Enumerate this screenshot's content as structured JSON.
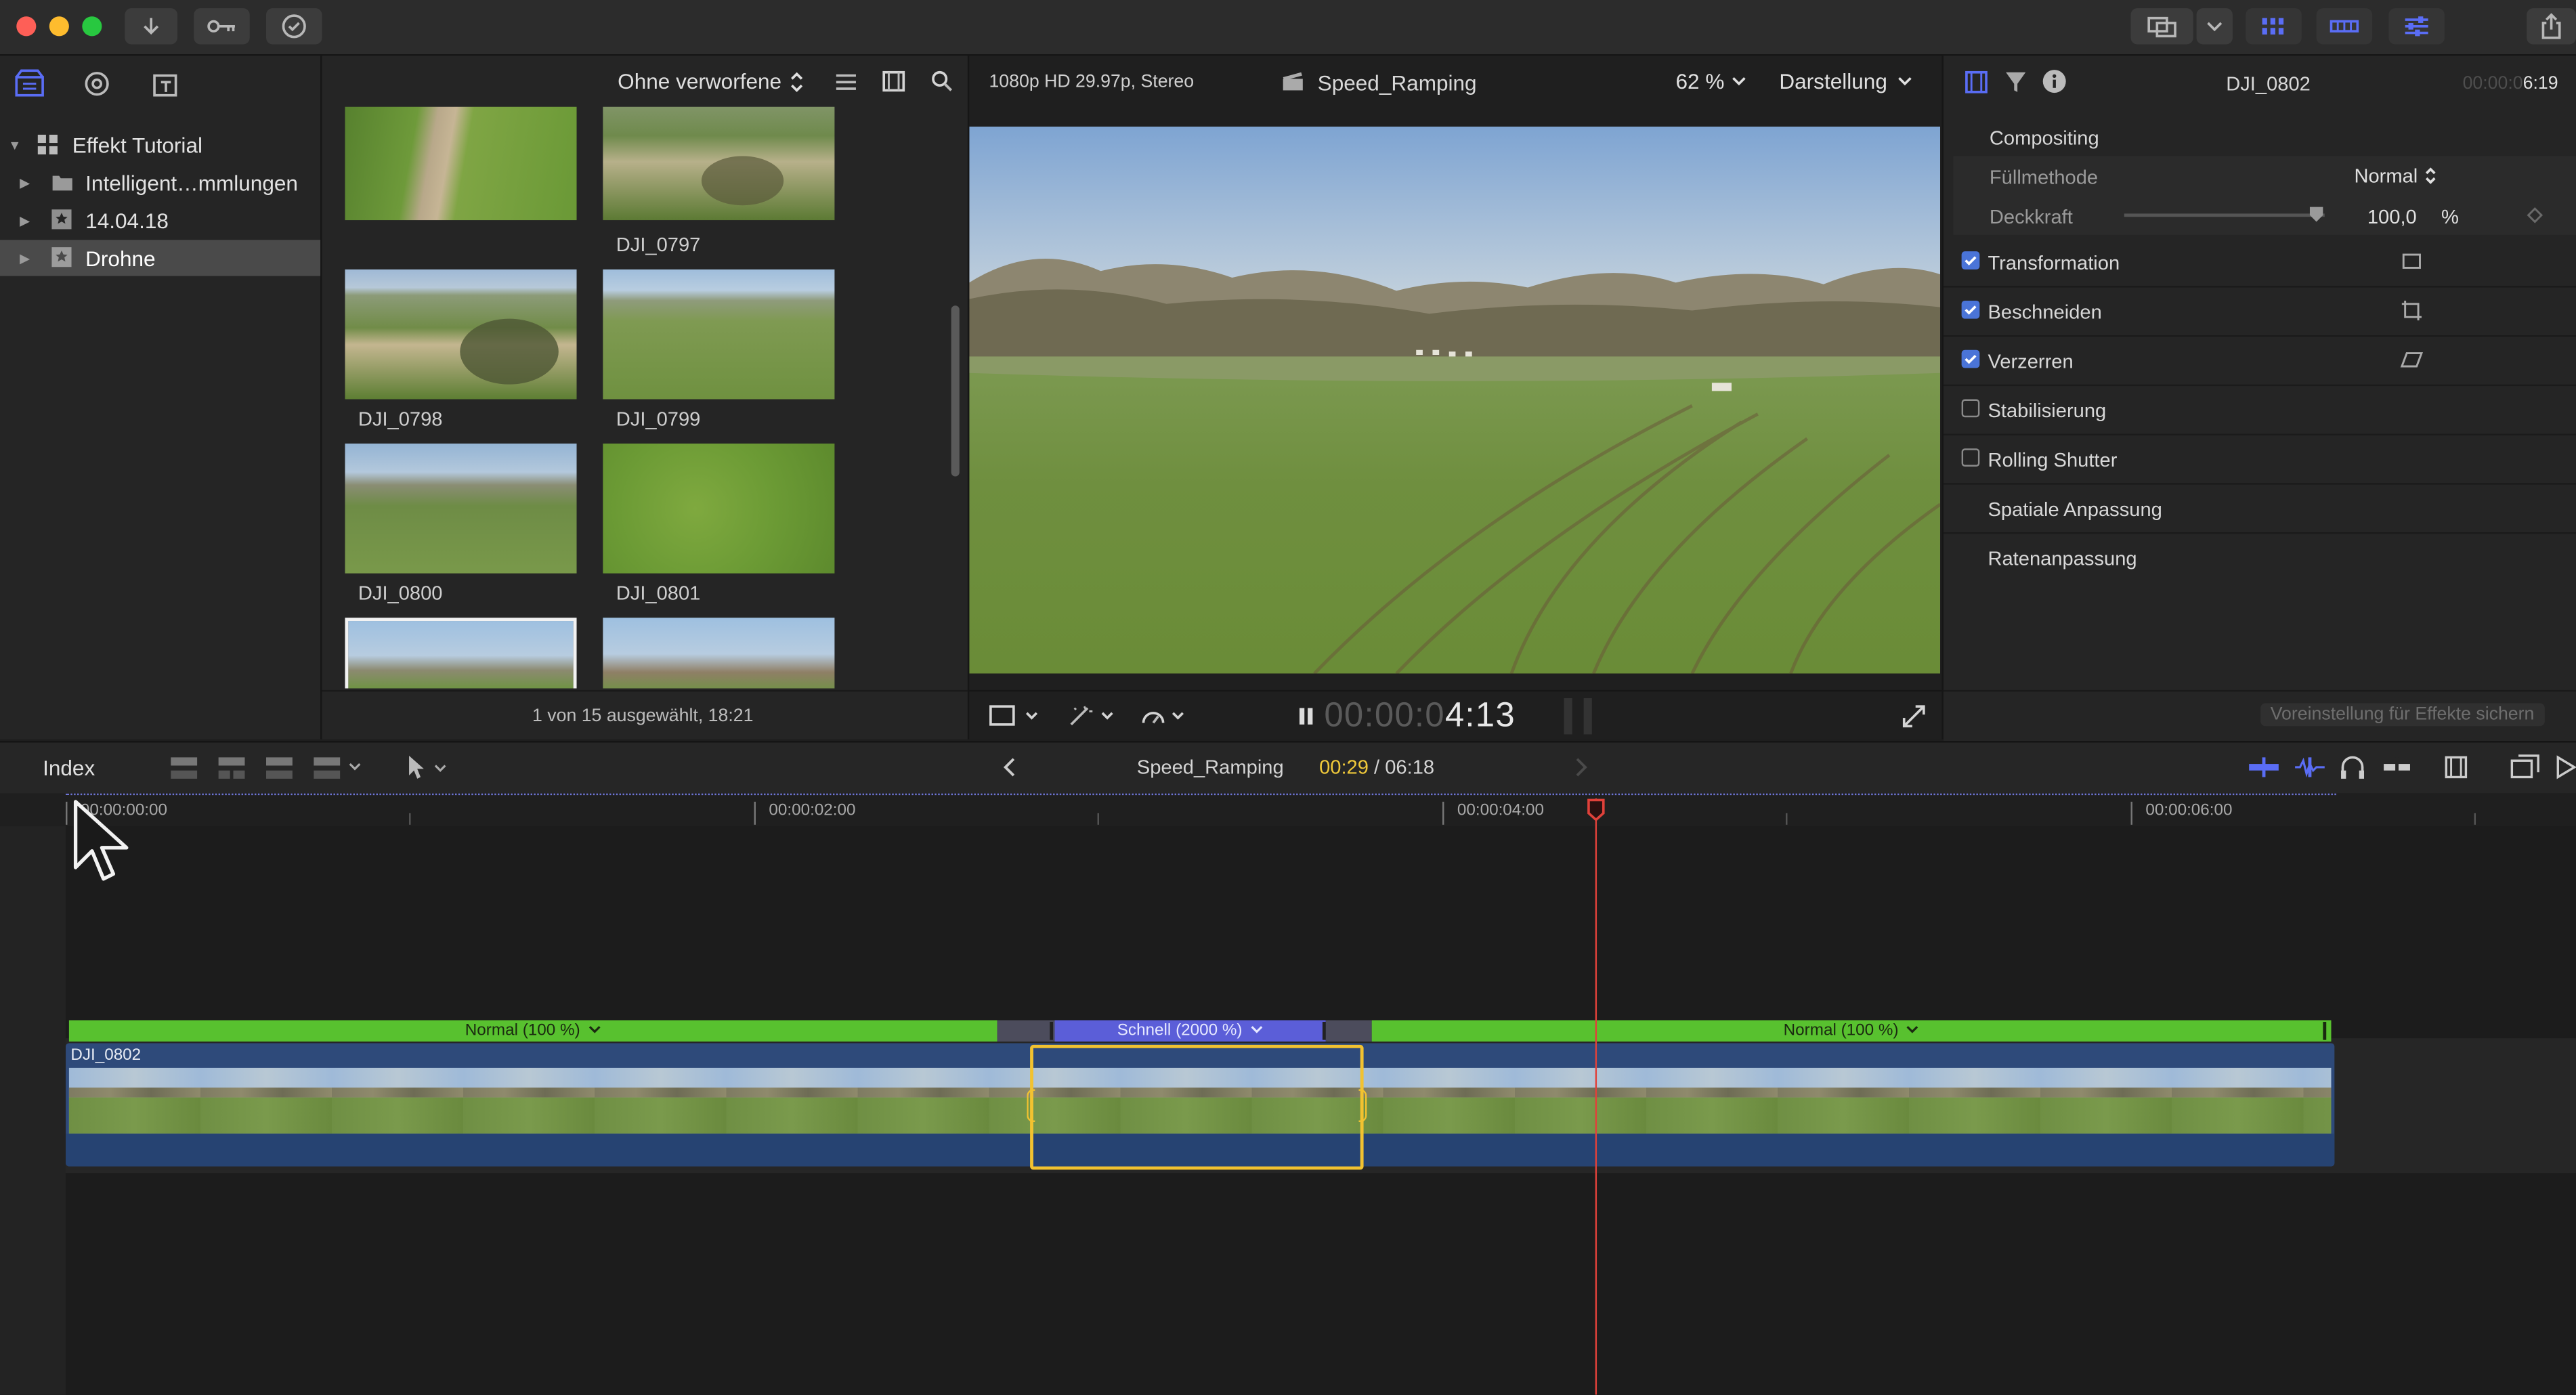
{
  "library": {
    "items": [
      {
        "label": "Effekt Tutorial",
        "expanded": true
      },
      {
        "label": "Intelligent…mmlungen"
      },
      {
        "label": "14.04.18"
      },
      {
        "label": "Drohne",
        "selected": true
      }
    ]
  },
  "browser": {
    "filter_label": "Ohne verworfene",
    "clips": [
      "DJI_0797",
      "DJI_0798",
      "DJI_0799",
      "DJI_0800",
      "DJI_0801"
    ],
    "status": "1 von 15 ausgewählt, 18:21"
  },
  "viewer": {
    "format": "1080p HD 29.97p, Stereo",
    "project": "Speed_Ramping",
    "zoom": "62 %",
    "display_menu": "Darstellung",
    "timecode_dim": "00:00:0",
    "timecode_bright": "4:13"
  },
  "inspector": {
    "clip_name": "DJI_0802",
    "duration_dim": "00:00:0",
    "duration": "6:19",
    "compositing_label": "Compositing",
    "blend_label": "Füllmethode",
    "blend_value": "Normal",
    "opacity_label": "Deckkraft",
    "opacity_value": "100,0",
    "opacity_unit": "%",
    "sections": [
      {
        "label": "Transformation",
        "checked": true,
        "icon": "transform-icon"
      },
      {
        "label": "Beschneiden",
        "checked": true,
        "icon": "crop-icon"
      },
      {
        "label": "Verzerren",
        "checked": true,
        "icon": "distort-icon"
      },
      {
        "label": "Stabilisierung",
        "checked": false
      },
      {
        "label": "Rolling Shutter",
        "checked": false
      },
      {
        "label": "Spatiale Anpassung"
      },
      {
        "label": "Ratenanpassung"
      }
    ],
    "save_preset": "Voreinstellung für Effekte sichern"
  },
  "timeline": {
    "index_label": "Index",
    "project": "Speed_Ramping",
    "position": "00:29",
    "separator": " / ",
    "duration": "06:18",
    "ruler": [
      "00:00:00:00",
      "00:00:02:00",
      "00:00:04:00",
      "00:00:06:00"
    ],
    "clip_name": "DJI_0802",
    "speed_segments": [
      {
        "label": "Normal (100 %)",
        "color": "#58c12f"
      },
      {
        "label": "Schnell (2000 %)",
        "color": "#5b5ed8"
      },
      {
        "label": "Normal (100 %)",
        "color": "#58c12f"
      }
    ]
  },
  "colors": {
    "accent": "#4a5cf0",
    "playhead": "#e0413a",
    "selection": "#f2c230",
    "speed_normal": "#58c12f",
    "speed_fast": "#5b5ed8",
    "timecode_yellow": "#f0c93a"
  }
}
